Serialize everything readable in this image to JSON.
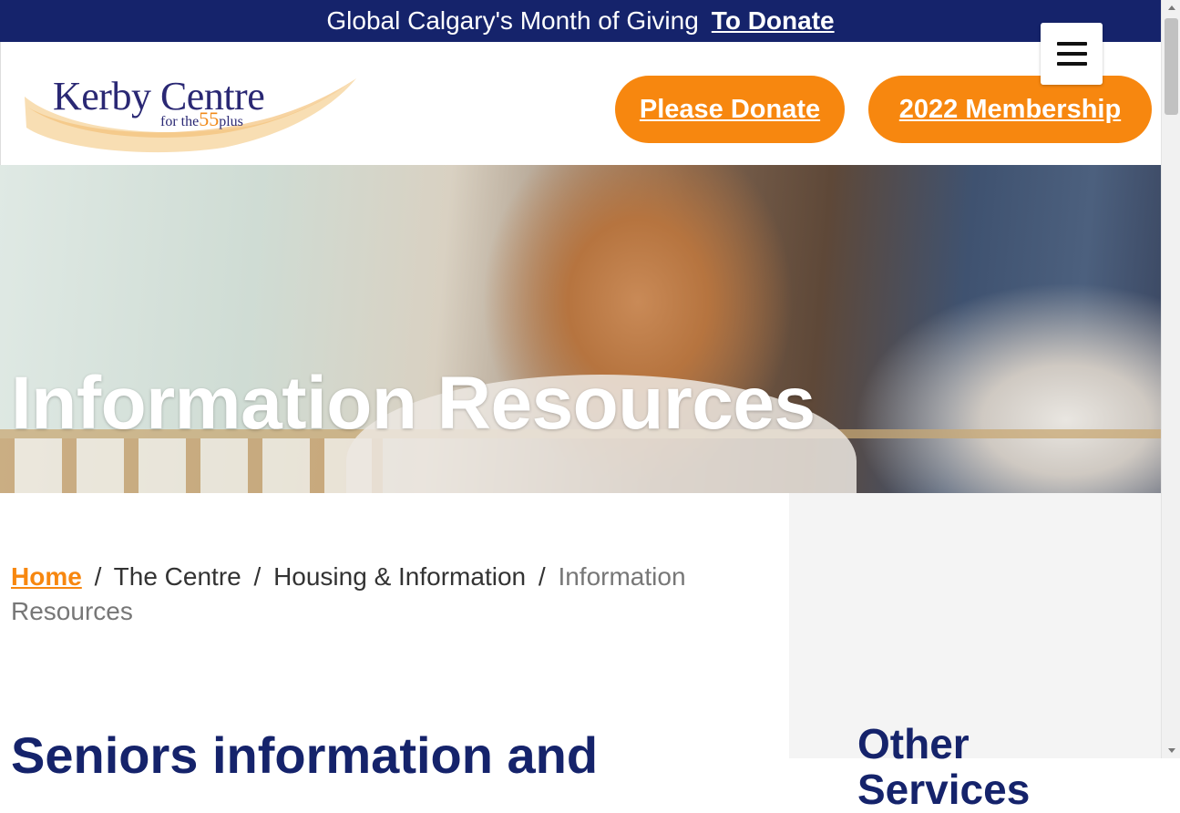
{
  "colors": {
    "navy": "#15236b",
    "orange": "#f7870f",
    "sidebar_bg": "#f4f4f4"
  },
  "topbar": {
    "text": "Global Calgary's Month of Giving",
    "link": "To Donate"
  },
  "menu": {
    "icon": "hamburger-menu-icon"
  },
  "logo": {
    "name": "Kerby Centre",
    "tag_prefix": "for the",
    "tag_number": "55",
    "tag_suffix": "plus"
  },
  "header": {
    "donate_label": "Please Donate",
    "membership_label": "2022 Membership"
  },
  "hero": {
    "title": "Information Resources"
  },
  "breadcrumb": {
    "home": "Home",
    "separator": "/",
    "items": [
      "The Centre",
      "Housing & Information"
    ],
    "current": "Information Resources"
  },
  "main": {
    "heading": "Seniors information and"
  },
  "sidebar": {
    "title": "Other Services"
  }
}
